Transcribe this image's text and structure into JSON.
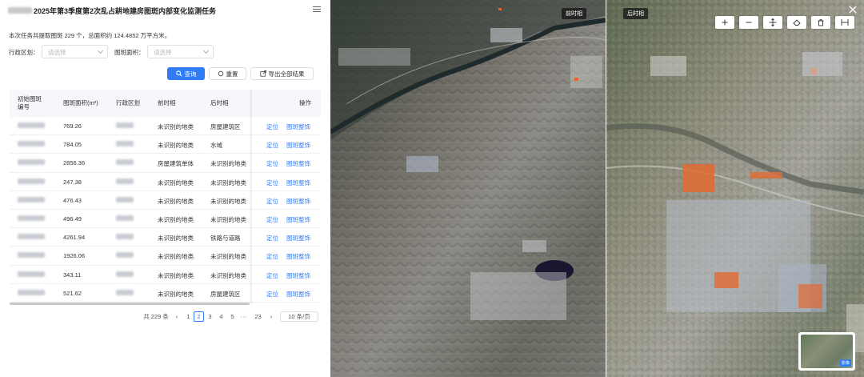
{
  "panel": {
    "title": "2025年第3季度第2次乱占耕地建房图斑内部变化监测任务",
    "summary": "本次任务共提取图斑 229 个，总面积约 124.4852 万平方米。",
    "filters": {
      "region_label": "行政区划：",
      "region_placeholder": "请选择",
      "area_label": "图斑面积：",
      "area_placeholder": "请选择"
    },
    "buttons": {
      "search": "查询",
      "reset": "重置",
      "export": "导出全部结果"
    },
    "table": {
      "headers": {
        "id_line1": "初始图斑",
        "id_line2": "编号",
        "area": "图斑面积(m²)",
        "region": "行政区划",
        "before": "前时相",
        "after": "后时相",
        "actions": "操作"
      },
      "action_locate": "定位",
      "action_fix": "图斑整饰",
      "rows": [
        {
          "area": "769.26",
          "before": "未识别的地类",
          "after": "房屋建筑区"
        },
        {
          "area": "784.05",
          "before": "未识别的地类",
          "after": "水域"
        },
        {
          "area": "2856.36",
          "before": "房屋建筑单体",
          "after": "未识别的地类"
        },
        {
          "area": "247.38",
          "before": "未识别的地类",
          "after": "未识别的地类"
        },
        {
          "area": "476.43",
          "before": "未识别的地类",
          "after": "未识别的地类"
        },
        {
          "area": "496.49",
          "before": "未识别的地类",
          "after": "未识别的地类"
        },
        {
          "area": "4261.94",
          "before": "未识别的地类",
          "after": "铁路与道路"
        },
        {
          "area": "1926.06",
          "before": "未识别的地类",
          "after": "未识别的地类"
        },
        {
          "area": "343.11",
          "before": "未识别的地类",
          "after": "未识别的地类"
        },
        {
          "area": "521.62",
          "before": "未识别的地类",
          "after": "房屋建筑区"
        }
      ]
    },
    "pagination": {
      "total": "共 229 条",
      "prev": "‹",
      "pages": [
        "1",
        "2",
        "3",
        "4",
        "5",
        "···",
        "23"
      ],
      "current": "2",
      "next": "›",
      "page_size": "10 条/页"
    }
  },
  "map": {
    "before_label": "前时相",
    "after_label": "后时相",
    "tools": [
      "plus-icon",
      "minus-icon",
      "move-icon",
      "eraser-icon",
      "trash-icon",
      "split-icon"
    ],
    "tool_text": {
      "plus": "+",
      "minus": "−"
    },
    "minimap_label": "影像"
  },
  "colors": {
    "primary": "#2f7cf6",
    "header_bg": "#f5f7fa",
    "highlight_orange": "#e8632c"
  }
}
